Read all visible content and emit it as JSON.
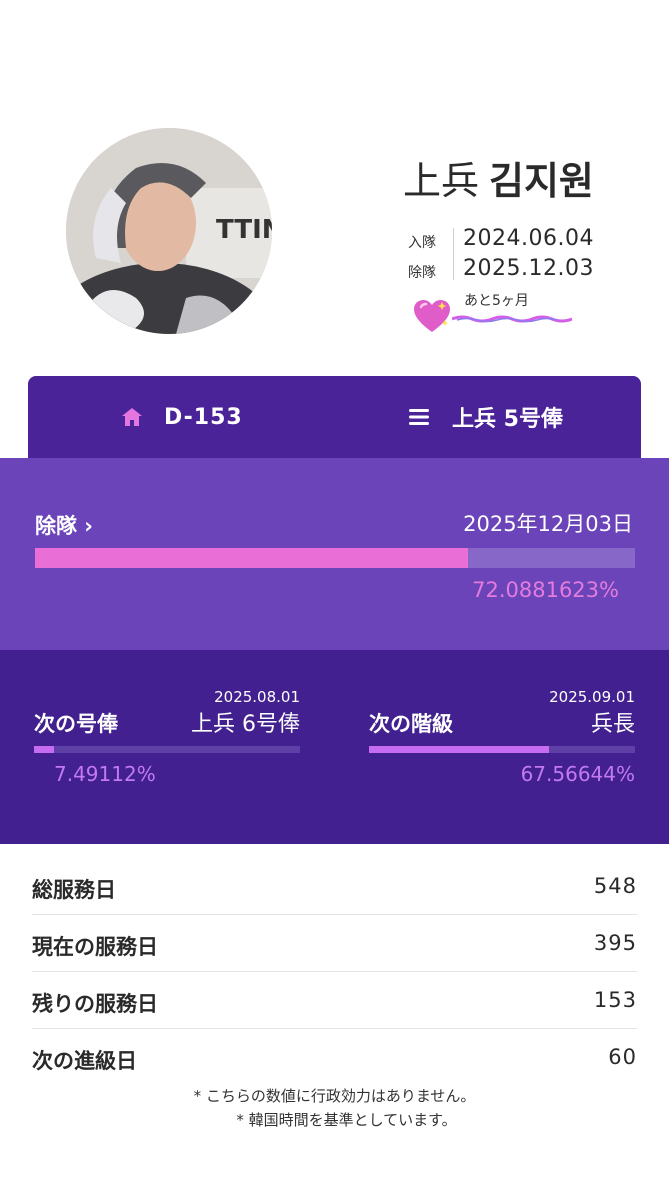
{
  "profile": {
    "rank": "上兵",
    "name": "김지원",
    "enlist_label": "入隊",
    "enlist_date": "2024.06.04",
    "discharge_label": "除隊",
    "discharge_date": "2025.12.03",
    "remaining_text": "あと5ヶ月",
    "heart_icon": "sparkling-heart-icon"
  },
  "top_bar": {
    "dday": "D-153",
    "rank_pay": "上兵 5号俸",
    "home_icon": "home-icon",
    "menu_icon": "menu-icon"
  },
  "discharge": {
    "label": "除隊 ›",
    "date": "2025年12月03日",
    "progress": 0.720881623,
    "percent_text": "72.0881623%"
  },
  "next": {
    "pay": {
      "date": "2025.08.01",
      "title": "次の号俸",
      "target": "上兵 6号俸",
      "progress": 0.0749112,
      "percent_text": "7.49112%"
    },
    "rank": {
      "date": "2025.09.01",
      "title": "次の階級",
      "target": "兵長",
      "progress": 0.6756644,
      "percent_text": "67.56644%"
    }
  },
  "stats": [
    {
      "label": "総服務日",
      "value": "548"
    },
    {
      "label": "現在の服務日",
      "value": "395"
    },
    {
      "label": "残りの服務日",
      "value": "153"
    },
    {
      "label": "次の進級日",
      "value": "60"
    }
  ],
  "notes": [
    "* こちらの数値に行政効力はありません。",
    "* 韓国時間を基準としています。"
  ],
  "colors": {
    "header": "#4a2398",
    "discharge_bg": "#6a44b8",
    "next_bg": "#43208f",
    "pink": "#e96fd6",
    "violet": "#c66cf2"
  }
}
